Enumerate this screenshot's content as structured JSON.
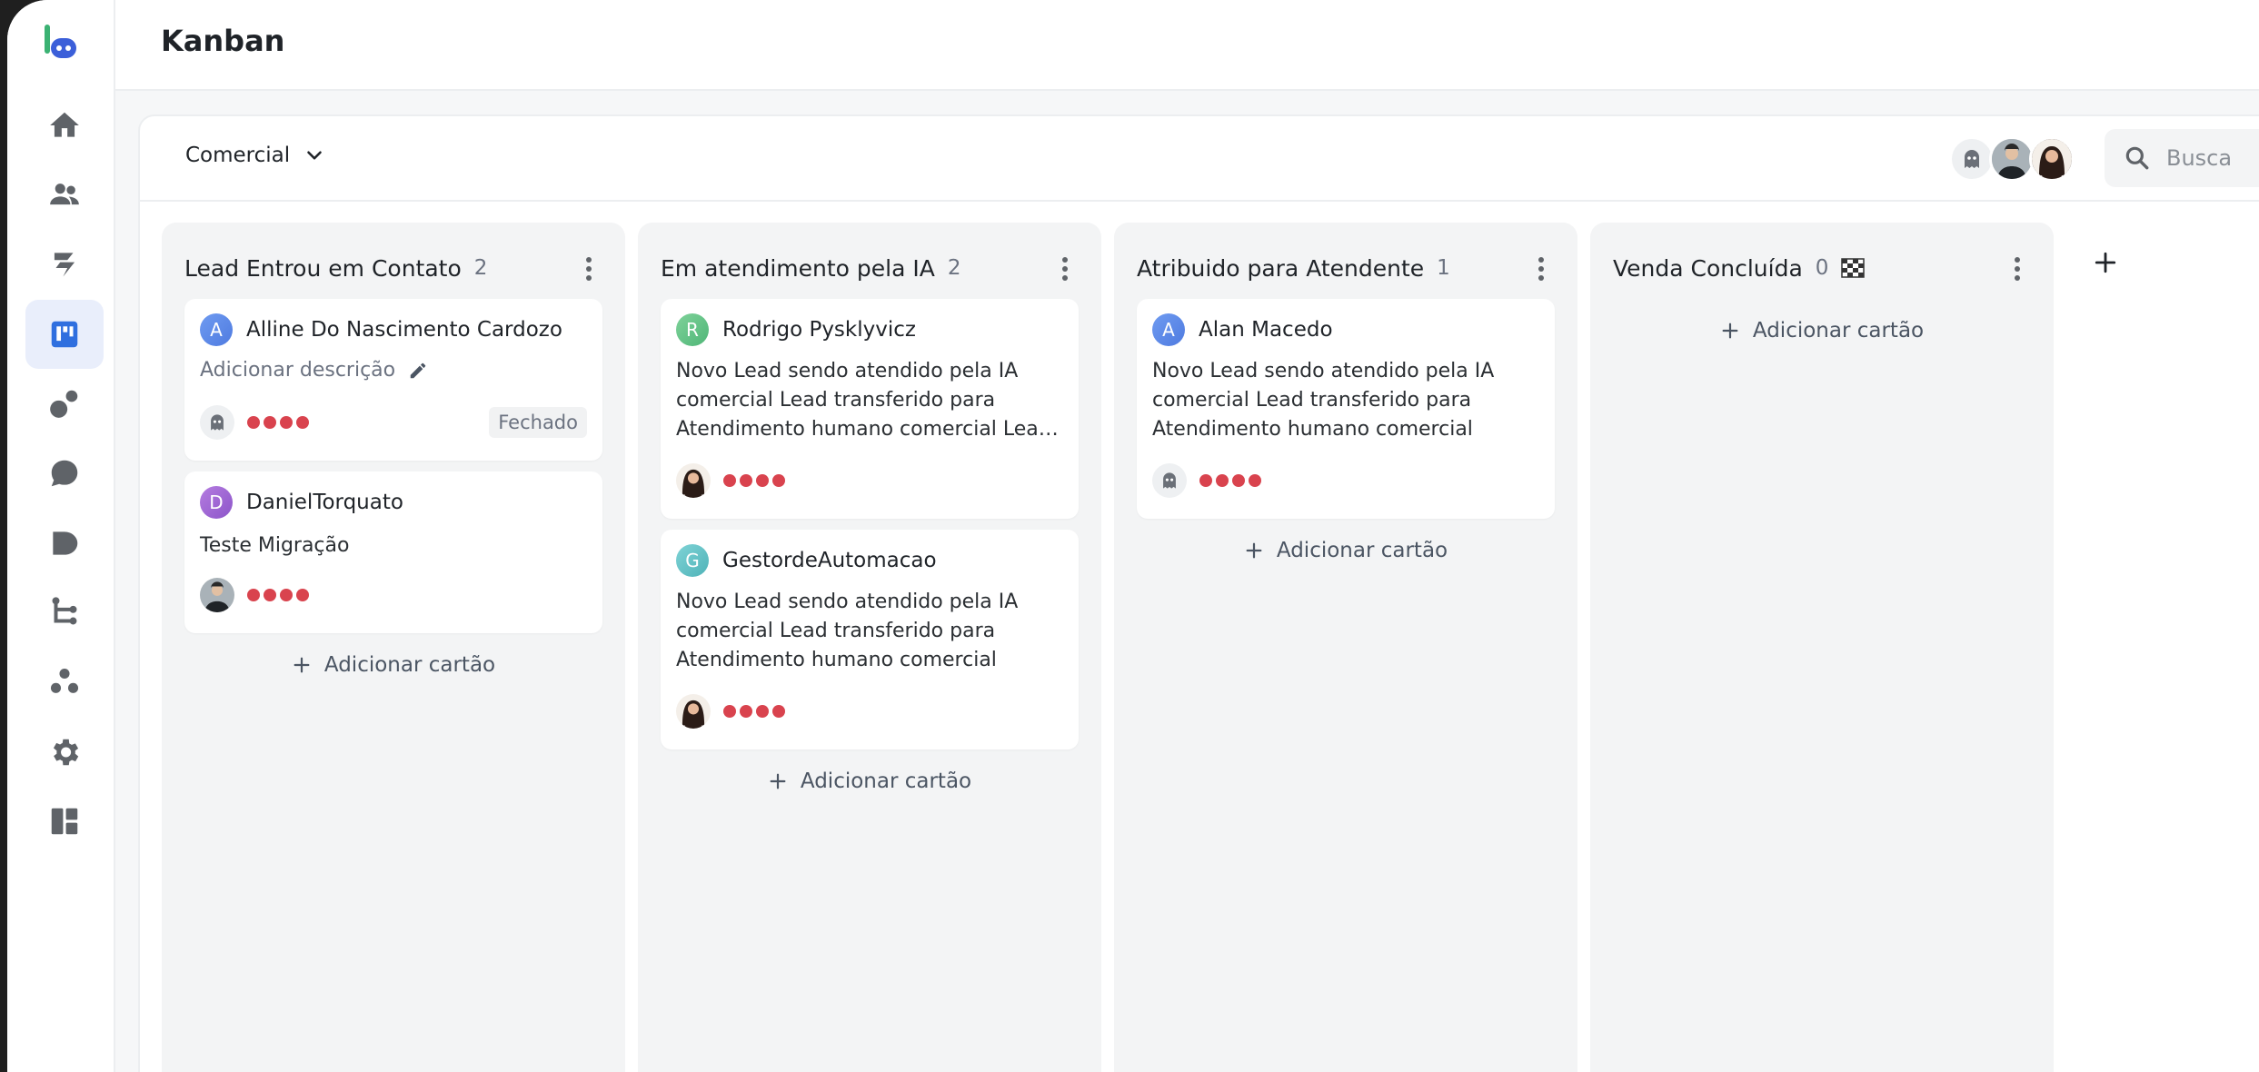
{
  "page": {
    "title": "Kanban"
  },
  "sidebar": {
    "items": [
      {
        "icon": "home-icon",
        "active": false
      },
      {
        "icon": "users-icon",
        "active": false
      },
      {
        "icon": "bolt-icon",
        "active": false
      },
      {
        "icon": "kanban-icon",
        "active": true
      },
      {
        "icon": "bubbles-icon",
        "active": false
      },
      {
        "icon": "chat-icon",
        "active": false
      },
      {
        "icon": "play-icon",
        "active": false
      },
      {
        "icon": "flow-icon",
        "active": false
      },
      {
        "icon": "group-icon",
        "active": false
      },
      {
        "icon": "gear-icon",
        "active": false
      },
      {
        "icon": "dashboard-icon",
        "active": false
      }
    ]
  },
  "board": {
    "pipeline": "Comercial",
    "search_placeholder": "Busca"
  },
  "colors": {
    "accent": "#2f6fdf",
    "priority_dot": "#d9434e",
    "column_bg": "#f3f4f5"
  },
  "columns": [
    {
      "title": "Lead Entrou em Contato",
      "count": "2",
      "add_label": "Adicionar cartão",
      "cards": [
        {
          "initial": "A",
          "name": "Alline Do Nascimento Cardozo",
          "add_description": "Adicionar descrição",
          "status": "Fechado"
        },
        {
          "initial": "D",
          "name": "DanielTorquato",
          "description": "Teste Migração"
        }
      ]
    },
    {
      "title": "Em atendimento pela IA",
      "count": "2",
      "add_label": "Adicionar cartão",
      "cards": [
        {
          "initial": "R",
          "name": "Rodrigo Pysklyvicz",
          "description": "Novo Lead sendo atendido pela IA comercial Lead transferido para Atendimento humano comercial Lead transferido"
        },
        {
          "initial": "G",
          "name": "GestordeAutomacao",
          "description": "Novo Lead sendo atendido pela IA comercial Lead transferido para Atendimento humano comercial"
        }
      ]
    },
    {
      "title": "Atribuido para Atendente",
      "count": "1",
      "add_label": "Adicionar cartão",
      "cards": [
        {
          "initial": "A",
          "name": "Alan Macedo",
          "description": "Novo Lead sendo atendido pela IA comercial Lead transferido para Atendimento humano comercial"
        }
      ]
    },
    {
      "title": "Venda Concluída",
      "count": "0",
      "add_label": "Adicionar cartão",
      "cards": []
    }
  ]
}
